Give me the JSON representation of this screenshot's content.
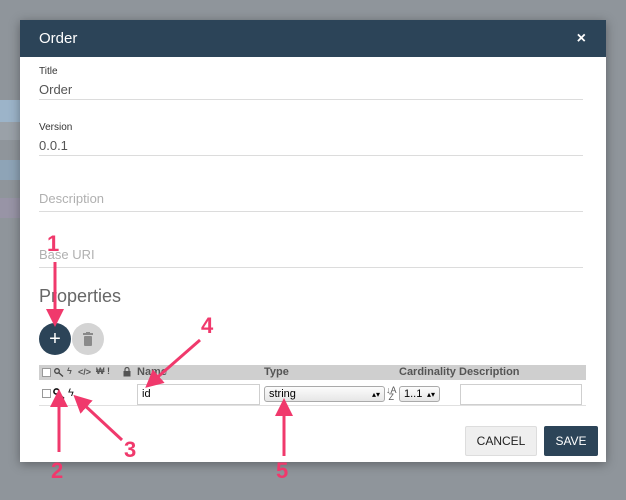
{
  "modal": {
    "title": "Order",
    "close_label": "×"
  },
  "form": {
    "title_label": "Title",
    "title_value": "Order",
    "version_label": "Version",
    "version_value": "0.0.1",
    "description_placeholder": "Description",
    "base_uri_placeholder": "Base URI"
  },
  "properties": {
    "section_title": "Properties",
    "add_icon": "+",
    "delete_icon": "trash-icon",
    "header": {
      "name": "Name",
      "type": "Type",
      "cardinality": "Cardinality",
      "description": "Description",
      "icons": [
        "key-icon",
        "lightning-icon",
        "code-icon",
        "currency-icon",
        "exclamation-icon",
        "lock-icon"
      ]
    },
    "rows": [
      {
        "name": "id",
        "type": "string",
        "cardinality": "1..1",
        "description": "",
        "is_key": true,
        "is_indexed": true
      }
    ]
  },
  "footer": {
    "cancel_label": "CANCEL",
    "save_label": "SAVE"
  },
  "annotations": [
    "1",
    "2",
    "3",
    "4",
    "5"
  ],
  "colors": {
    "header_bg": "#2c4458",
    "annotation": "#f0396c",
    "backdrop": "#8f959b"
  }
}
